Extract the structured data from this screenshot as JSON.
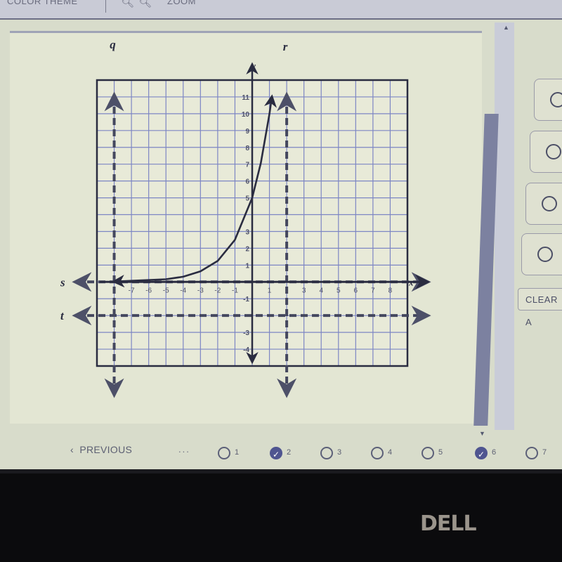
{
  "toolbar": {
    "color_theme_label": "COLOR THEME",
    "zoom_label": "ZOOM",
    "zoom_out_icon": "magnifier-minus",
    "zoom_in_icon": "magnifier-plus"
  },
  "answers": {
    "options": [
      {
        "selected": false
      },
      {
        "selected": false
      },
      {
        "selected": false
      },
      {
        "selected": false
      }
    ],
    "clear_label": "CLEAR A"
  },
  "navigation": {
    "previous_label": "PREVIOUS",
    "previous_icon": "‹",
    "ellipsis": "...",
    "questions": [
      {
        "number": "1",
        "answered": false
      },
      {
        "number": "2",
        "answered": true
      },
      {
        "number": "3",
        "answered": false
      },
      {
        "number": "4",
        "answered": false
      },
      {
        "number": "5",
        "answered": false
      },
      {
        "number": "6",
        "answered": true
      },
      {
        "number": "7",
        "answered": false
      }
    ]
  },
  "monitor": {
    "brand": "DELL"
  },
  "chart_data": {
    "type": "line",
    "title": "",
    "xlabel": "x",
    "ylabel": "y",
    "xlim": [
      -9,
      9
    ],
    "ylim": [
      -5,
      12
    ],
    "grid": true,
    "x_tick_labels": [
      "-7",
      "-6",
      "-5",
      "-4",
      "-3",
      "-2",
      "-1",
      "1",
      "3",
      "4",
      "5",
      "6",
      "7",
      "8"
    ],
    "x_tick_values": [
      -7,
      -6,
      -5,
      -4,
      -3,
      -2,
      -1,
      1,
      3,
      4,
      5,
      6,
      7,
      8
    ],
    "y_tick_labels": [
      "11",
      "10",
      "9",
      "8",
      "7",
      "6",
      "5",
      "3",
      "2",
      "1",
      "-1",
      "-3",
      "-4"
    ],
    "y_tick_values": [
      11,
      10,
      9,
      8,
      7,
      6,
      5,
      3,
      2,
      1,
      -1,
      -3,
      -4
    ],
    "curve": {
      "name": "exponential",
      "description": "y = 5 * 2^x",
      "points": [
        {
          "x": -8,
          "y": 0.02
        },
        {
          "x": -5,
          "y": 0.16
        },
        {
          "x": -4,
          "y": 0.31
        },
        {
          "x": -3,
          "y": 0.63
        },
        {
          "x": -2,
          "y": 1.25
        },
        {
          "x": -1,
          "y": 2.5
        },
        {
          "x": 0,
          "y": 5
        },
        {
          "x": 0.5,
          "y": 7.07
        },
        {
          "x": 1,
          "y": 10
        },
        {
          "x": 1.14,
          "y": 11
        }
      ]
    },
    "reference_lines": [
      {
        "label": "q",
        "orientation": "vertical",
        "value": -8,
        "style": "dashed"
      },
      {
        "label": "r",
        "orientation": "vertical",
        "value": 2,
        "style": "dashed"
      },
      {
        "label": "s",
        "orientation": "horizontal",
        "value": 0,
        "style": "dashed"
      },
      {
        "label": "t",
        "orientation": "horizontal",
        "value": -2,
        "style": "dashed"
      }
    ]
  }
}
